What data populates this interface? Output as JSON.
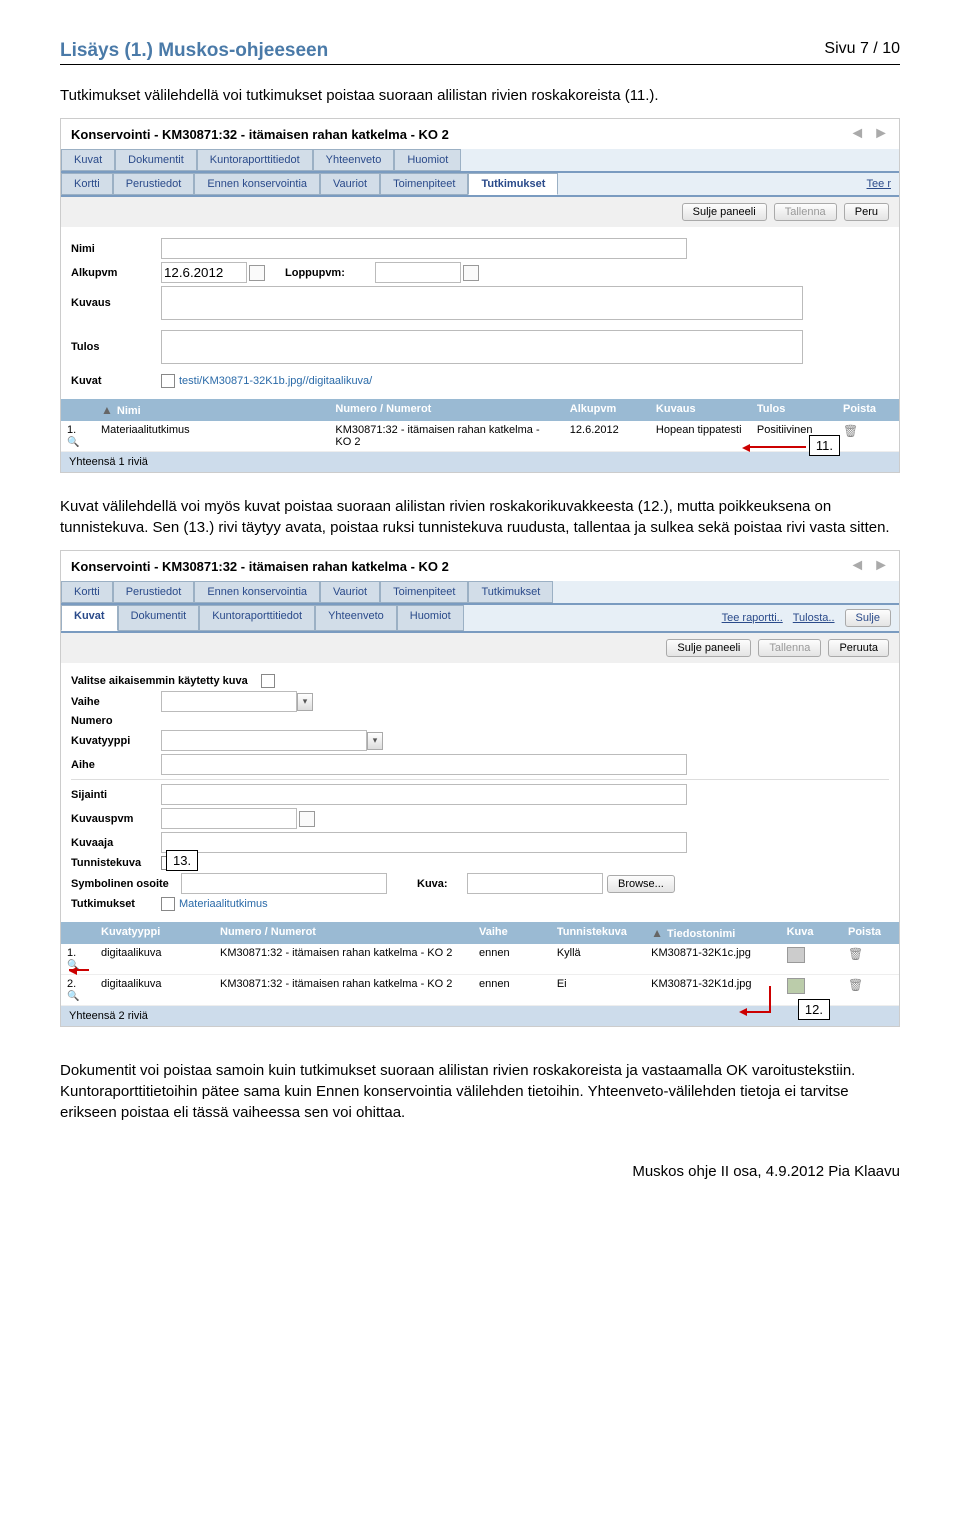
{
  "header": {
    "title": "Lisäys (1.) Muskos-ohjeeseen",
    "page": "Sivu 7 / 10"
  },
  "p1": "Tutkimukset välilehdellä voi tutkimukset poistaa suoraan alilistan rivien roskakoreista (11.).",
  "p2": "Kuvat välilehdellä voi myös kuvat poistaa suoraan alilistan rivien roskakorikuvakkeesta (12.), mutta poikkeuksena on tunnistekuva. Sen (13.) rivi täytyy avata, poistaa ruksi tunnistekuva ruudusta, tallentaa ja sulkea sekä poistaa rivi vasta sitten.",
  "p3": "Dokumentit voi poistaa samoin kuin tutkimukset suoraan alilistan rivien roskakoreista ja vastaamalla OK varoitustekstiin. Kuntoraporttitietoihin pätee sama kuin Ennen konservointia välilehden tietoihin. Yhteenveto-välilehden tietoja ei tarvitse erikseen poistaa eli tässä vaiheessa sen voi ohittaa.",
  "callouts": {
    "c11": "11.",
    "c12": "12.",
    "c13": "13."
  },
  "sc1": {
    "title": "Konservointi  - KM30871:32 - itämaisen rahan katkelma - KO 2",
    "tabs_top": [
      "Kuvat",
      "Dokumentit",
      "Kuntoraporttitiedot",
      "Yhteenveto",
      "Huomiot"
    ],
    "tabs_bot": [
      "Kortti",
      "Perustiedot",
      "Ennen konservointia",
      "Vauriot",
      "Toimenpiteet",
      "Tutkimukset"
    ],
    "tee_r": "Tee r",
    "btn_sulje": "Sulje paneeli",
    "btn_tallenna": "Tallenna",
    "btn_peru": "Peru",
    "labels": {
      "nimi": "Nimi",
      "alkupvm": "Alkupvm",
      "loppupvm": "Loppupvm:",
      "kuvaus": "Kuvaus",
      "tulos": "Tulos",
      "kuvat": "Kuvat"
    },
    "alkupvm": "12.6.2012",
    "kuva_link": "testi/KM30871-32K1b.jpg//digitaalikuva/",
    "grid": {
      "headers": [
        "Nimi",
        "Numero / Numerot",
        "Alkupvm",
        "Kuvaus",
        "Tulos",
        "Poista"
      ],
      "row": [
        "Materiaalitutkimus",
        "KM30871:32 - itämaisen rahan katkelma - KO 2",
        "12.6.2012",
        "Hopean tippatesti",
        "Positiivinen"
      ],
      "footer": "Yhteensä 1 riviä"
    }
  },
  "sc2": {
    "title": "Konservointi  - KM30871:32 - itämaisen rahan katkelma - KO 2",
    "tabs_top": [
      "Kortti",
      "Perustiedot",
      "Ennen konservointia",
      "Vauriot",
      "Toimenpiteet",
      "Tutkimukset"
    ],
    "tabs_bot": [
      "Kuvat",
      "Dokumentit",
      "Kuntoraporttitiedot",
      "Yhteenveto",
      "Huomiot"
    ],
    "tee_rap": "Tee raportti..",
    "tulosta": "Tulosta..",
    "sulje": "Sulje",
    "btn_sulje": "Sulje paneeli",
    "btn_tallenna": "Tallenna",
    "btn_peruuta": "Peruuta",
    "labels": {
      "valitse": "Valitse aikaisemmin käytetty kuva",
      "vaihe": "Vaihe",
      "numero": "Numero",
      "kuvatyyppi": "Kuvatyyppi",
      "aihe": "Aihe",
      "sijainti": "Sijainti",
      "kuvauspvm": "Kuvauspvm",
      "kuvaaja": "Kuvaaja",
      "tunnistekuva": "Tunnistekuva",
      "symbolinen": "Symbolinen osoite",
      "kuva": "Kuva:",
      "browse": "Browse...",
      "tutkimukset": "Tutkimukset",
      "mat": "Materiaalitutkimus"
    },
    "grid": {
      "headers": [
        "Kuvatyyppi",
        "Numero / Numerot",
        "Vaihe",
        "Tunnistekuva",
        "Tiedostonimi",
        "Kuva",
        "Poista"
      ],
      "rows": [
        [
          "digitaalikuva",
          "KM30871:32 - itämaisen rahan katkelma - KO 2",
          "ennen",
          "Kyllä",
          "KM30871-32K1c.jpg"
        ],
        [
          "digitaalikuva",
          "KM30871:32 - itämaisen rahan katkelma - KO 2",
          "ennen",
          "Ei",
          "KM30871-32K1d.jpg"
        ]
      ],
      "footer": "Yhteensä 2 riviä"
    }
  },
  "footer": "Muskos ohje II osa, 4.9.2012 Pia Klaavu"
}
